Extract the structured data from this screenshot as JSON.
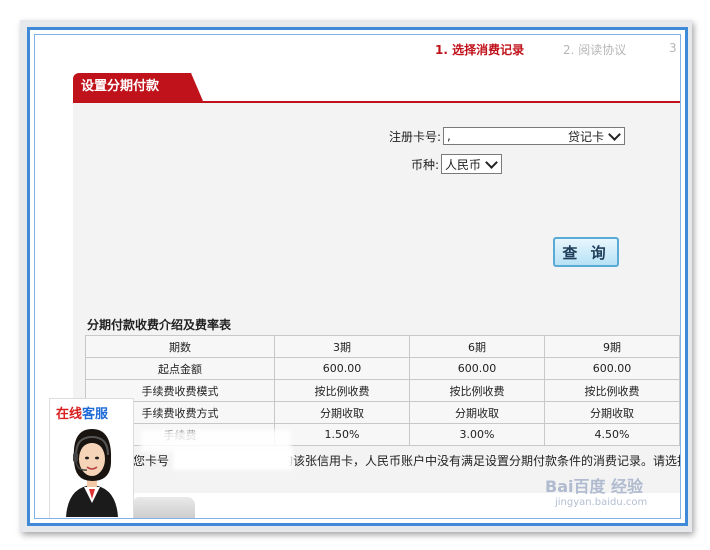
{
  "steps": [
    {
      "label": "1. 选择消费记录",
      "state": "active"
    },
    {
      "label": "2. 阅读协议",
      "state": "inactive"
    },
    {
      "label": "3",
      "state": "inactive"
    }
  ],
  "tab": {
    "label": "设置分期付款"
  },
  "form": {
    "card_label": "注册卡号:",
    "card_value": ",",
    "card_type": "贷记卡",
    "currency_label": "币种:",
    "currency_value": "人民币",
    "query_label": "查 询"
  },
  "fee_table": {
    "title": "分期付款收费介绍及费率表",
    "header": [
      "期数",
      "3期",
      "6期",
      "9期"
    ],
    "rows": [
      [
        "起点金额",
        "600.00",
        "600.00",
        "600.00"
      ],
      [
        "手续费收费模式",
        "按比例收费",
        "按比例收费",
        "按比例收费"
      ],
      [
        "手续费收费方式",
        "分期收取",
        "分期收取",
        "分期收取"
      ],
      [
        "手续费",
        "1.50%",
        "3.00%",
        "4.50%"
      ]
    ]
  },
  "message": {
    "prefix": "您卡号",
    "text": "的该张信用卡，人民币账户中没有满足设置分期付款条件的消费记录。请选择其"
  },
  "service": {
    "title_red": "在线",
    "title_blue": "客服"
  },
  "watermark": {
    "brand": "Bai百度 经验",
    "url": "jingyan.baidu.com"
  },
  "colors": {
    "accent_red": "#c0121b",
    "frame_blue": "#3e8ad8",
    "button_blue": "#b7e2f6"
  }
}
